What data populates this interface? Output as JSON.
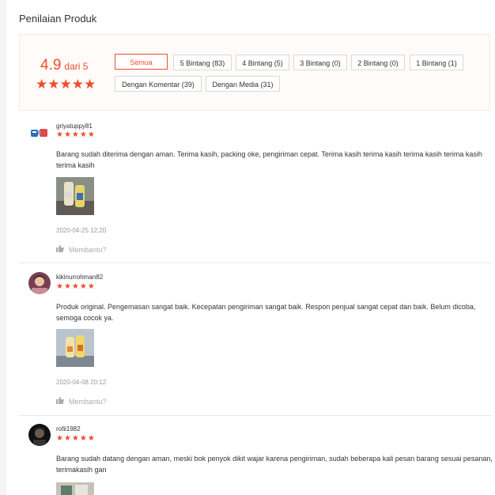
{
  "section": {
    "title": "Penilaian Produk"
  },
  "rating": {
    "score": "4.9",
    "out_of": "dari 5",
    "stars": "★★★★★",
    "value": 4.9
  },
  "filters": [
    {
      "label": "Semua",
      "active": true
    },
    {
      "label": "5 Bintang (83)"
    },
    {
      "label": "4 Bintang (5)"
    },
    {
      "label": "3 Bintang (0)"
    },
    {
      "label": "2 Bintang (0)"
    },
    {
      "label": "1 Bintang (1)"
    },
    {
      "label": "Dengan Komentar (39)"
    },
    {
      "label": "Dengan Media (31)"
    }
  ],
  "reviews": [
    {
      "username": "griyatuppy81",
      "stars": "★★★★★",
      "rating": 5,
      "text": "Barang sudah diterima dengan aman. Terima kasih, packing oke, pengiriman cepat. Terima kasih terima kasih terima kasih terima kasih terima kasih",
      "date": "2020-04-25 12:20",
      "helpful": "Membantu?"
    },
    {
      "username": "kikinurrohman82",
      "stars": "★★★★★",
      "rating": 5,
      "text": "Produk original. Pengemasan sangat baik. Kecepatan pengiriman sangat baik. Respon penjual sangat cepat dan baik. Belum dicoba, semoga cocok ya.",
      "date": "2020-04-08 20:12",
      "helpful": "Membantu?"
    },
    {
      "username": "rofii1982",
      "stars": "★★★★★",
      "rating": 5,
      "text": "Barang sudah datang dengan aman, meski bok penyok dikit wajar karena pengiriman, sudah beberapa kali pesan barang sesuai pesanan, terimakasih gan"
    }
  ],
  "colors": {
    "accent": "#ee4d2d",
    "summary_bg": "#fffbf8",
    "muted": "#999999"
  }
}
